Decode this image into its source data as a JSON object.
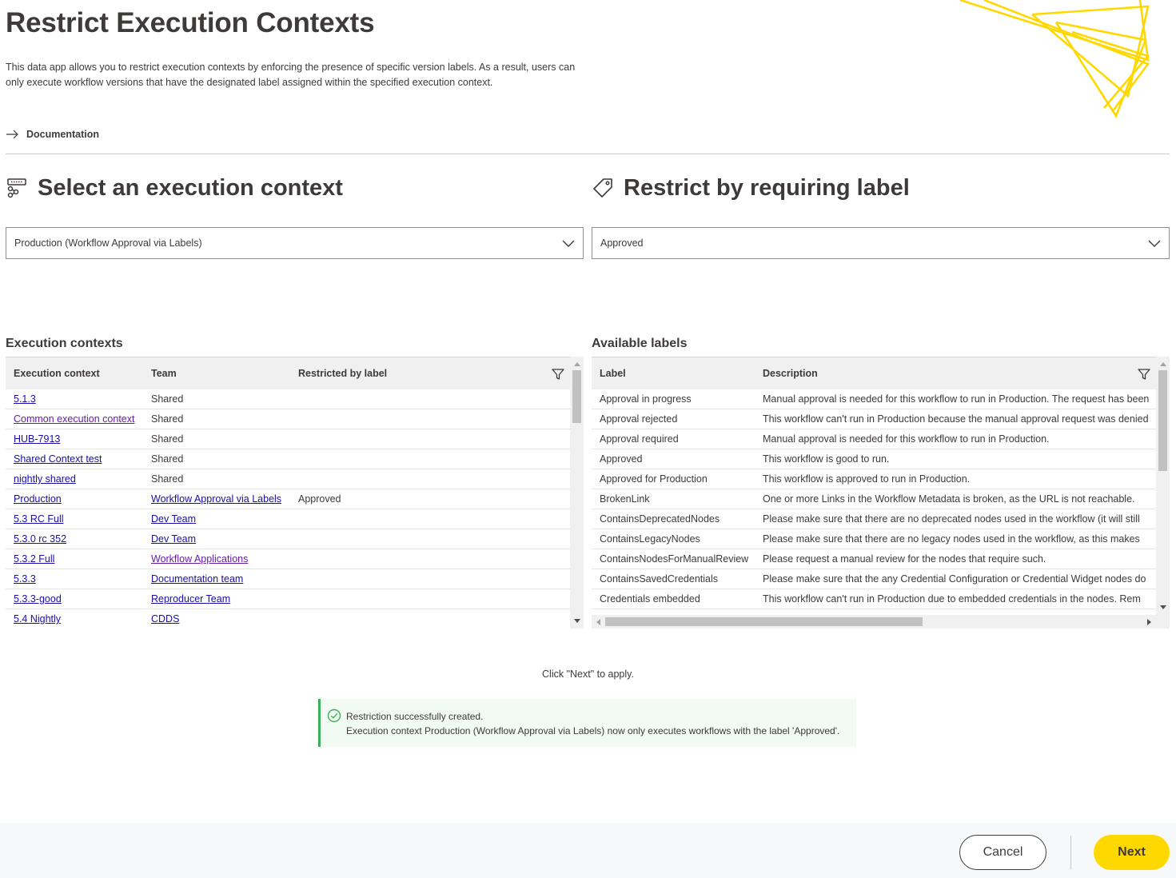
{
  "header": {
    "title": "Restrict Execution Contexts",
    "description": "This data app allows you to restrict execution contexts by enforcing the presence of specific version labels. As a result, users can only execute workflow versions that have the designated label assigned within the specified execution context.",
    "documentation_link": "Documentation"
  },
  "left_section": {
    "title": "Select an execution context",
    "icon": "execution-context-icon",
    "select_value": "Production (Workflow Approval via Labels)"
  },
  "right_section": {
    "title": "Restrict by requiring label",
    "icon": "tag-icon",
    "select_value": "Approved"
  },
  "execution_table": {
    "title": "Execution contexts",
    "columns": [
      "Execution context",
      "Team",
      "Restricted by label"
    ],
    "rows": [
      {
        "context": "5.1.3",
        "team": "Shared",
        "team_link": false,
        "label": ""
      },
      {
        "context": "Common execution context",
        "team": "Shared",
        "team_link": false,
        "label": "",
        "visited": true
      },
      {
        "context": "HUB-7913",
        "team": "Shared",
        "team_link": false,
        "label": ""
      },
      {
        "context": "Shared Context test",
        "team": "Shared",
        "team_link": false,
        "label": ""
      },
      {
        "context": "nightly shared",
        "team": "Shared",
        "team_link": false,
        "label": ""
      },
      {
        "context": "Production",
        "team": "Workflow Approval via Labels",
        "team_link": true,
        "label": "Approved"
      },
      {
        "context": "5.3 RC Full",
        "team": "Dev Team",
        "team_link": true,
        "label": ""
      },
      {
        "context": "5.3.0 rc 352",
        "team": "Dev Team",
        "team_link": true,
        "label": ""
      },
      {
        "context": "5.3.2 Full",
        "team": "Workflow Applications",
        "team_link": true,
        "label": "",
        "team_visited": true
      },
      {
        "context": "5.3.3",
        "team": "Documentation team",
        "team_link": true,
        "label": ""
      },
      {
        "context": "5.3.3-good",
        "team": "Reproducer Team",
        "team_link": true,
        "label": ""
      },
      {
        "context": "5.4 Nightly",
        "team": "CDDS",
        "team_link": true,
        "label": ""
      }
    ]
  },
  "labels_table": {
    "title": "Available labels",
    "columns": [
      "Label",
      "Description"
    ],
    "rows": [
      {
        "label": "Approval in progress",
        "description": "Manual approval is needed for this workflow to run in Production. The request has been"
      },
      {
        "label": "Approval rejected",
        "description": "This workflow can't run in Production because the manual approval request was denied"
      },
      {
        "label": "Approval required",
        "description": "Manual approval is needed for this workflow to run in Production."
      },
      {
        "label": "Approved",
        "description": "This workflow is good to run."
      },
      {
        "label": "Approved for Production",
        "description": "This workflow is approved to run in Production."
      },
      {
        "label": "BrokenLink",
        "description": "One or more Links in the Workflow Metadata is broken, as the URL is not reachable."
      },
      {
        "label": "ContainsDeprecatedNodes",
        "description": "Please make sure that there are no deprecated nodes used in the workflow (it will still"
      },
      {
        "label": "ContainsLegacyNodes",
        "description": "Please make sure that there are no legacy nodes used in the workflow, as this makes"
      },
      {
        "label": "ContainsNodesForManualReview",
        "description": "Please request a manual review for the nodes that require such."
      },
      {
        "label": "ContainsSavedCredentials",
        "description": "Please make sure that the any Credential Configuration or Credential Widget nodes do"
      },
      {
        "label": "Credentials embedded",
        "description": "This workflow can't run in Production due to embedded credentials in the nodes. Rem"
      }
    ]
  },
  "hint": "Click \"Next\" to apply.",
  "toast": {
    "line1": "Restriction successfully created.",
    "line2": "Execution context Production (Workflow Approval via Labels) now only executes workflows with the label 'Approved'."
  },
  "footer": {
    "cancel_label": "Cancel",
    "next_label": "Next"
  },
  "colors": {
    "accent_yellow": "#ffd800",
    "success_green": "#3cb05a",
    "link_blue": "#1a0dab",
    "link_visited": "#681da8",
    "text_dark": "#3e3a39"
  }
}
